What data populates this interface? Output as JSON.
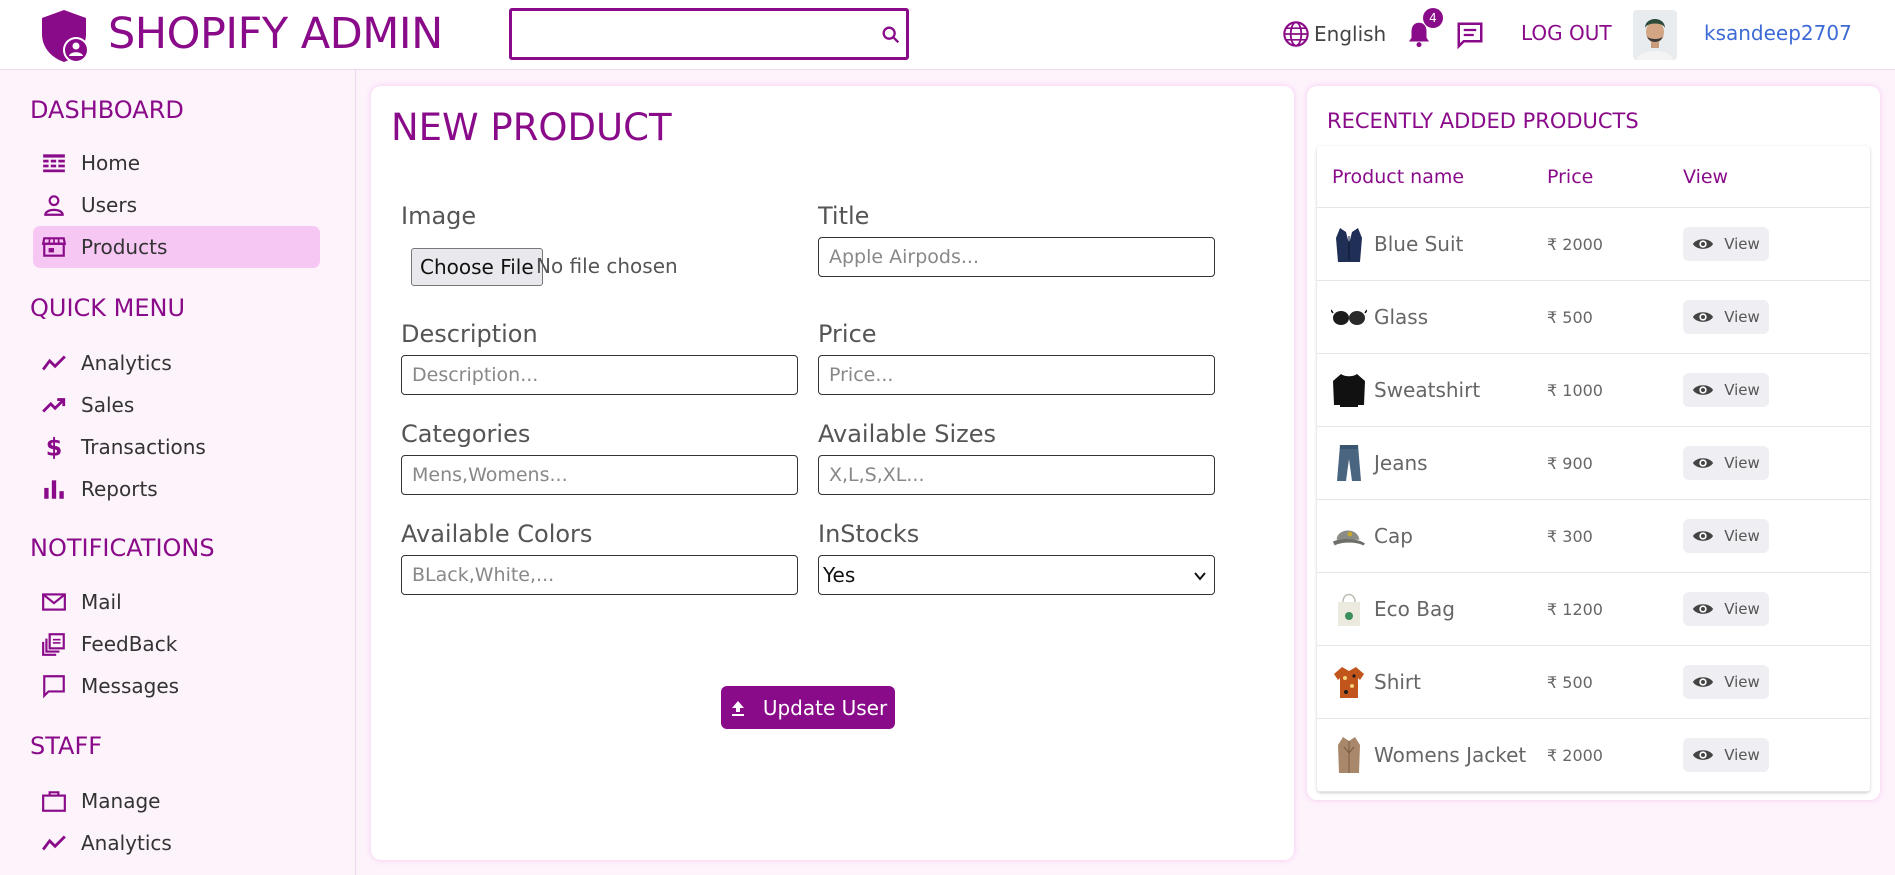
{
  "header": {
    "title": "SHOPIFY ADMIN",
    "search_placeholder": "",
    "language": "English",
    "notification_count": "4",
    "logout": "LOG OUT",
    "username": "ksandeep2707"
  },
  "sidebar": {
    "sections": [
      {
        "title": "DASHBOARD",
        "items": [
          {
            "label": "Home",
            "icon": "dashboard-icon"
          },
          {
            "label": "Users",
            "icon": "person-icon"
          },
          {
            "label": "Products",
            "icon": "store-icon",
            "active": true
          }
        ]
      },
      {
        "title": "QUICK MENU",
        "items": [
          {
            "label": "Analytics",
            "icon": "line-chart-icon"
          },
          {
            "label": "Sales",
            "icon": "trending-up-icon"
          },
          {
            "label": "Transactions",
            "icon": "dollar-icon"
          },
          {
            "label": "Reports",
            "icon": "bar-chart-icon"
          }
        ]
      },
      {
        "title": "NOTIFICATIONS",
        "items": [
          {
            "label": "Mail",
            "icon": "mail-icon"
          },
          {
            "label": "FeedBack",
            "icon": "library-icon"
          },
          {
            "label": "Messages",
            "icon": "chat-bubble-icon"
          }
        ]
      },
      {
        "title": "STAFF",
        "items": [
          {
            "label": "Manage",
            "icon": "briefcase-icon"
          },
          {
            "label": "Analytics",
            "icon": "line-chart-icon"
          }
        ]
      }
    ]
  },
  "form": {
    "title": "NEW PRODUCT",
    "image_label": "Image",
    "file_button": "Choose File",
    "file_note": "No file chosen",
    "title_label": "Title",
    "title_placeholder": "Apple Airpods...",
    "description_label": "Description",
    "description_placeholder": "Description...",
    "price_label": "Price",
    "price_placeholder": "Price...",
    "categories_label": "Categories",
    "categories_placeholder": "Mens,Womens...",
    "sizes_label": "Available Sizes",
    "sizes_placeholder": "X,L,S,XL...",
    "colors_label": "Available Colors",
    "colors_placeholder": "BLack,White,...",
    "instock_label": "InStocks",
    "instock_value": "Yes",
    "submit": "Update User"
  },
  "recent": {
    "title": "RECENTLY ADDED PRODUCTS",
    "columns": [
      "Product name",
      "Price",
      "View"
    ],
    "rows": [
      {
        "name": "Blue Suit",
        "price": "₹ 2000",
        "view": "View",
        "thumb": "suit"
      },
      {
        "name": "Glass",
        "price": "₹ 500",
        "view": "View",
        "thumb": "glasses"
      },
      {
        "name": "Sweatshirt",
        "price": "₹ 1000",
        "view": "View",
        "thumb": "sweatshirt"
      },
      {
        "name": "Jeans",
        "price": "₹ 900",
        "view": "View",
        "thumb": "jeans"
      },
      {
        "name": "Cap",
        "price": "₹ 300",
        "view": "View",
        "thumb": "cap"
      },
      {
        "name": "Eco Bag",
        "price": "₹ 1200",
        "view": "View",
        "thumb": "bag"
      },
      {
        "name": "Shirt",
        "price": "₹ 500",
        "view": "View",
        "thumb": "shirt"
      },
      {
        "name": "Womens Jacket",
        "price": "₹ 2000",
        "view": "View",
        "thumb": "jacket"
      }
    ]
  },
  "colors": {
    "accent": "#8a0b8a",
    "active_bg": "#f7c7f4",
    "link": "#3d6ad6"
  }
}
